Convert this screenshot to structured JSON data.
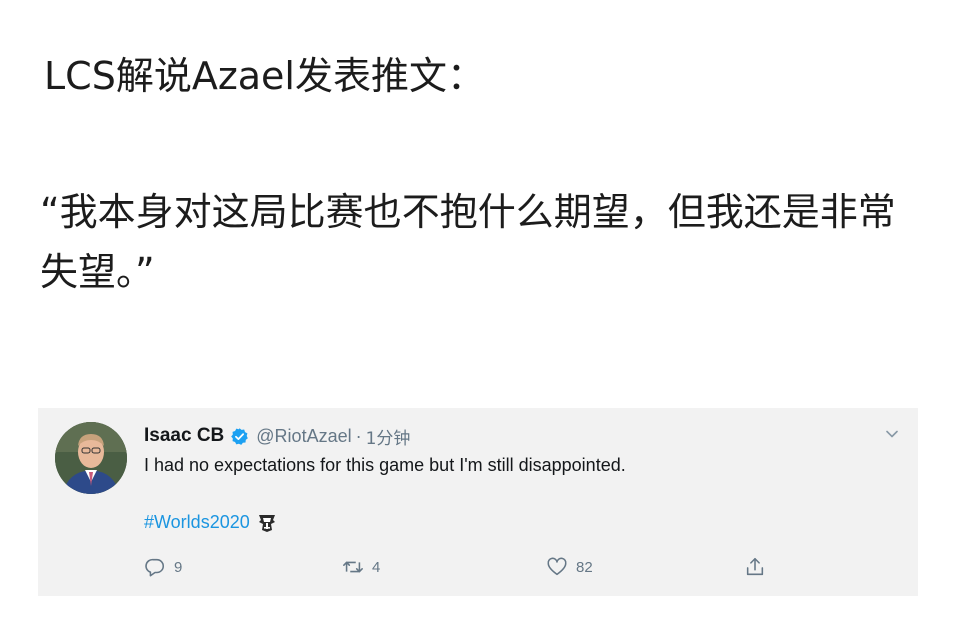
{
  "post": {
    "headline": "LCS解说Azael发表推文：",
    "quote": "“我本身对这局比赛也不抱什么期望，但我还是非常失望。”"
  },
  "tweet": {
    "display_name": "Isaac CB",
    "handle": "@RiotAzael",
    "separator": "·",
    "time": "1分钟",
    "text": "I had no expectations for this game but I'm still disappointed.",
    "hashtag": "#Worlds2020",
    "replies": "9",
    "retweets": "4",
    "likes": "82",
    "icons": {
      "verified": "verified-badge-icon",
      "menu": "chevron-down-icon",
      "reply": "reply-icon",
      "retweet": "retweet-icon",
      "like": "heart-icon",
      "share": "share-icon",
      "hashflag": "worlds-trophy-icon"
    },
    "colors": {
      "link": "#1b95e0",
      "muted": "#657786",
      "card_bg": "#f2f2f2"
    }
  }
}
